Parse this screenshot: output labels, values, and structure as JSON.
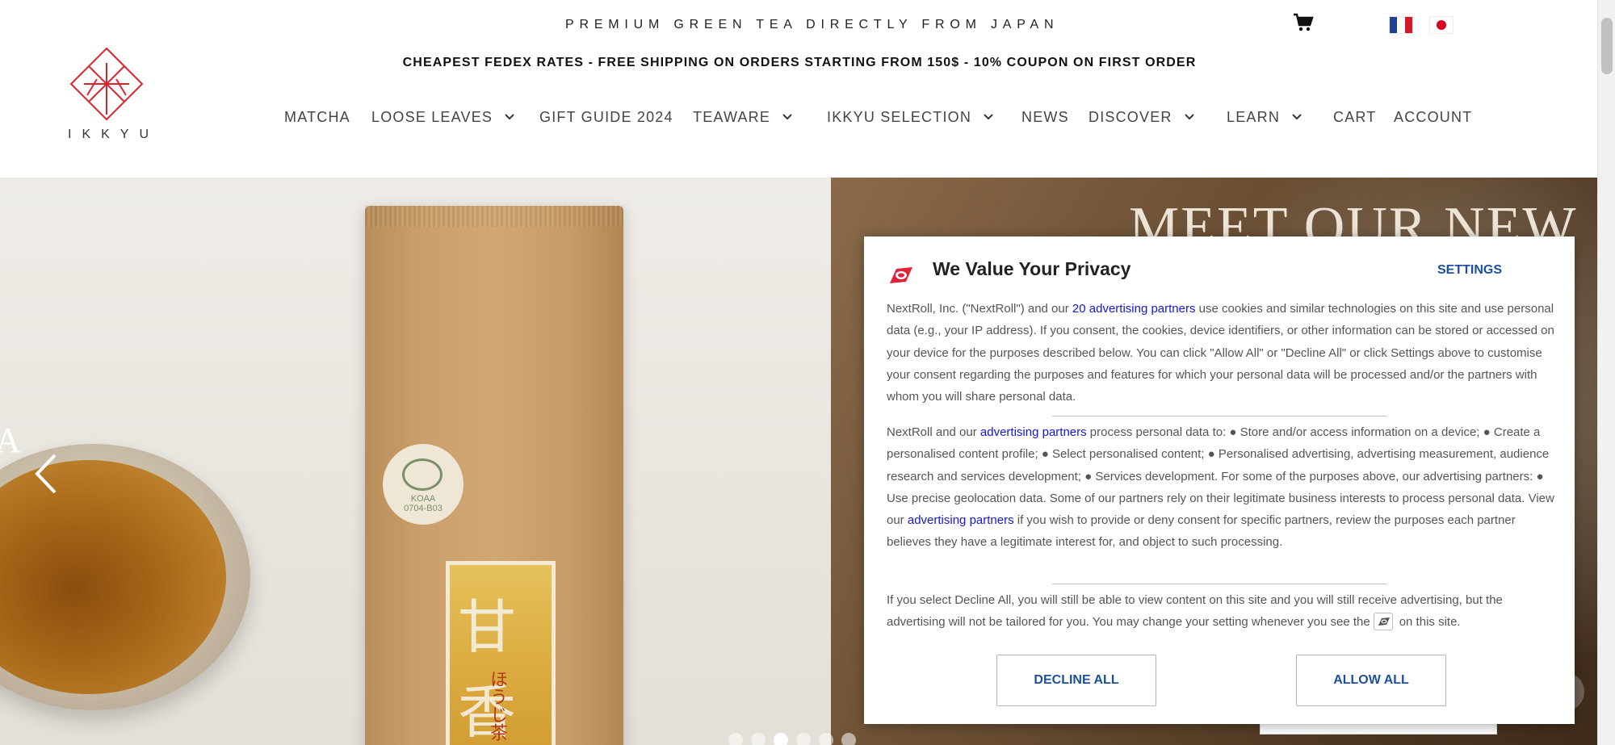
{
  "header": {
    "tagline": "PREMIUM GREEN TEA DIRECTLY FROM JAPAN",
    "promo": "CHEAPEST FEDEX RATES - FREE SHIPPING ON ORDERS STARTING FROM 150$ - 10% COUPON ON FIRST ORDER",
    "logo_text": "IKKYU",
    "colors": {
      "logo_red": "#d9252f",
      "text": "#444444"
    }
  },
  "nav": {
    "matcha": "MATCHA",
    "loose_leaves": "LOOSE LEAVES",
    "gift_guide": "GIFT GUIDE 2024",
    "teaware": "TEAWARE",
    "ikkyu_selection": "IKKYU SELECTION",
    "news": "NEWS",
    "discover": "DISCOVER",
    "learn": "LEARN",
    "cart": "CART",
    "account": "ACCOUNT"
  },
  "hero": {
    "headline": "MEET OUR NEW",
    "left_letter": "A",
    "seal_text": [
      "KOAA",
      "0704-B03"
    ],
    "label_kanji": "甘香",
    "label_sub": "ほうじ茶",
    "slides": 6,
    "active_slide": 3
  },
  "consent": {
    "title": "We Value Your Privacy",
    "settings_label": "SETTINGS",
    "p1_a": "NextRoll, Inc. (\"NextRoll\") and our ",
    "p1_link": "20 advertising partners",
    "p1_b": " use cookies and similar technologies on this site and use personal data (e.g., your IP address). If you consent, the cookies, device identifiers, or other information can be stored or accessed on your device for the purposes described below. You can click \"Allow All\" or \"Decline All\" or click Settings above to customise your consent regarding the purposes and features for which your personal data will be processed and/or the partners with whom you will share personal data.",
    "p2_a": "NextRoll and our ",
    "p2_link1": "advertising partners",
    "p2_b": " process personal data to: ● Store and/or access information on a device; ● Create a personalised content profile; ● Select personalised content; ● Personalised advertising, advertising measurement, audience research and services development; ● Services development. For some of the purposes above, our advertising partners: ● Use precise geolocation data. Some of our partners rely on their legitimate business interests to process personal data. View our ",
    "p2_link2": "advertising partners",
    "p2_c": " if you wish to provide or deny consent for specific partners, review the purposes each partner believes they have a legitimate interest for, and object to such processing.",
    "p3_a": "If you select Decline All, you will still be able to view content on this site and you will still receive advertising, but the advertising will not be tailored for you. You may change your setting whenever you see the",
    "p3_b": "on this site.",
    "decline_label": "DECLINE ALL",
    "allow_label": "ALLOW ALL",
    "colors": {
      "link": "#1515d6",
      "button_text": "#1d4fa1",
      "brand": "#e0233b"
    }
  },
  "icons": {
    "cart": "shopping-cart-icon",
    "flag_fr": "french-flag-icon",
    "flag_jp": "japanese-flag-icon",
    "chevron": "chevron-down-icon",
    "prev": "chevron-left-icon",
    "nextroll": "nextroll-logo-icon"
  }
}
